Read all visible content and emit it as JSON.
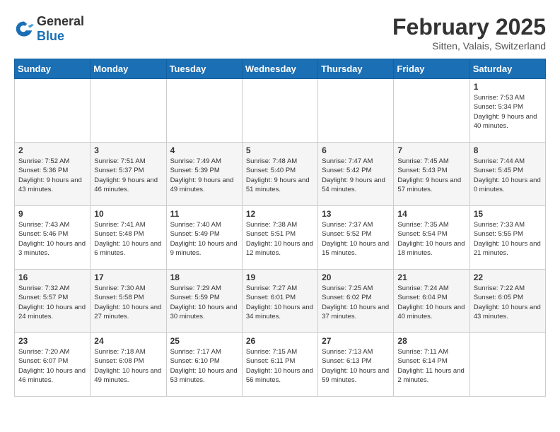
{
  "logo": {
    "general": "General",
    "blue": "Blue"
  },
  "title": "February 2025",
  "location": "Sitten, Valais, Switzerland",
  "headers": [
    "Sunday",
    "Monday",
    "Tuesday",
    "Wednesday",
    "Thursday",
    "Friday",
    "Saturday"
  ],
  "weeks": [
    [
      {
        "day": "",
        "info": ""
      },
      {
        "day": "",
        "info": ""
      },
      {
        "day": "",
        "info": ""
      },
      {
        "day": "",
        "info": ""
      },
      {
        "day": "",
        "info": ""
      },
      {
        "day": "",
        "info": ""
      },
      {
        "day": "1",
        "info": "Sunrise: 7:53 AM\nSunset: 5:34 PM\nDaylight: 9 hours and 40 minutes."
      }
    ],
    [
      {
        "day": "2",
        "info": "Sunrise: 7:52 AM\nSunset: 5:36 PM\nDaylight: 9 hours and 43 minutes."
      },
      {
        "day": "3",
        "info": "Sunrise: 7:51 AM\nSunset: 5:37 PM\nDaylight: 9 hours and 46 minutes."
      },
      {
        "day": "4",
        "info": "Sunrise: 7:49 AM\nSunset: 5:39 PM\nDaylight: 9 hours and 49 minutes."
      },
      {
        "day": "5",
        "info": "Sunrise: 7:48 AM\nSunset: 5:40 PM\nDaylight: 9 hours and 51 minutes."
      },
      {
        "day": "6",
        "info": "Sunrise: 7:47 AM\nSunset: 5:42 PM\nDaylight: 9 hours and 54 minutes."
      },
      {
        "day": "7",
        "info": "Sunrise: 7:45 AM\nSunset: 5:43 PM\nDaylight: 9 hours and 57 minutes."
      },
      {
        "day": "8",
        "info": "Sunrise: 7:44 AM\nSunset: 5:45 PM\nDaylight: 10 hours and 0 minutes."
      }
    ],
    [
      {
        "day": "9",
        "info": "Sunrise: 7:43 AM\nSunset: 5:46 PM\nDaylight: 10 hours and 3 minutes."
      },
      {
        "day": "10",
        "info": "Sunrise: 7:41 AM\nSunset: 5:48 PM\nDaylight: 10 hours and 6 minutes."
      },
      {
        "day": "11",
        "info": "Sunrise: 7:40 AM\nSunset: 5:49 PM\nDaylight: 10 hours and 9 minutes."
      },
      {
        "day": "12",
        "info": "Sunrise: 7:38 AM\nSunset: 5:51 PM\nDaylight: 10 hours and 12 minutes."
      },
      {
        "day": "13",
        "info": "Sunrise: 7:37 AM\nSunset: 5:52 PM\nDaylight: 10 hours and 15 minutes."
      },
      {
        "day": "14",
        "info": "Sunrise: 7:35 AM\nSunset: 5:54 PM\nDaylight: 10 hours and 18 minutes."
      },
      {
        "day": "15",
        "info": "Sunrise: 7:33 AM\nSunset: 5:55 PM\nDaylight: 10 hours and 21 minutes."
      }
    ],
    [
      {
        "day": "16",
        "info": "Sunrise: 7:32 AM\nSunset: 5:57 PM\nDaylight: 10 hours and 24 minutes."
      },
      {
        "day": "17",
        "info": "Sunrise: 7:30 AM\nSunset: 5:58 PM\nDaylight: 10 hours and 27 minutes."
      },
      {
        "day": "18",
        "info": "Sunrise: 7:29 AM\nSunset: 5:59 PM\nDaylight: 10 hours and 30 minutes."
      },
      {
        "day": "19",
        "info": "Sunrise: 7:27 AM\nSunset: 6:01 PM\nDaylight: 10 hours and 34 minutes."
      },
      {
        "day": "20",
        "info": "Sunrise: 7:25 AM\nSunset: 6:02 PM\nDaylight: 10 hours and 37 minutes."
      },
      {
        "day": "21",
        "info": "Sunrise: 7:24 AM\nSunset: 6:04 PM\nDaylight: 10 hours and 40 minutes."
      },
      {
        "day": "22",
        "info": "Sunrise: 7:22 AM\nSunset: 6:05 PM\nDaylight: 10 hours and 43 minutes."
      }
    ],
    [
      {
        "day": "23",
        "info": "Sunrise: 7:20 AM\nSunset: 6:07 PM\nDaylight: 10 hours and 46 minutes."
      },
      {
        "day": "24",
        "info": "Sunrise: 7:18 AM\nSunset: 6:08 PM\nDaylight: 10 hours and 49 minutes."
      },
      {
        "day": "25",
        "info": "Sunrise: 7:17 AM\nSunset: 6:10 PM\nDaylight: 10 hours and 53 minutes."
      },
      {
        "day": "26",
        "info": "Sunrise: 7:15 AM\nSunset: 6:11 PM\nDaylight: 10 hours and 56 minutes."
      },
      {
        "day": "27",
        "info": "Sunrise: 7:13 AM\nSunset: 6:13 PM\nDaylight: 10 hours and 59 minutes."
      },
      {
        "day": "28",
        "info": "Sunrise: 7:11 AM\nSunset: 6:14 PM\nDaylight: 11 hours and 2 minutes."
      },
      {
        "day": "",
        "info": ""
      }
    ]
  ]
}
